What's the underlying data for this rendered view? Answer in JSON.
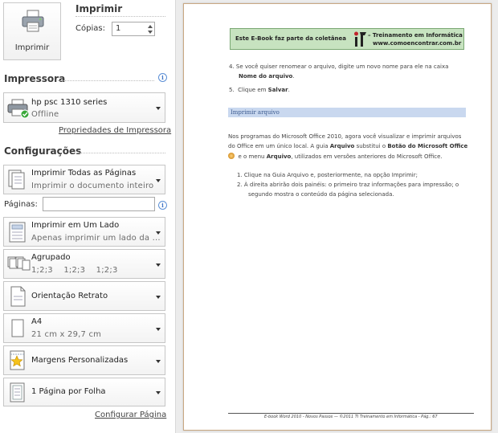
{
  "print_button": {
    "label": "Imprimir"
  },
  "header": {
    "title": "Imprimir"
  },
  "copies": {
    "label": "Cópias:",
    "value": "1"
  },
  "printer_section": {
    "title": "Impressora",
    "printer_name": "hp psc 1310 series",
    "printer_status": "Offline",
    "properties_link": "Propriedades de Impressora"
  },
  "settings": {
    "title": "Configurações",
    "items": [
      {
        "title": "Imprimir Todas as Páginas",
        "subtitle": "Imprimir o documento inteiro"
      },
      {
        "title": "Imprimir em Um Lado",
        "subtitle": "Apenas imprimir um lado da ..."
      },
      {
        "title": "Agrupado",
        "subtitle": "1;2;3    1;2;3    1;2;3"
      },
      {
        "title": "Orientação Retrato",
        "subtitle": ""
      },
      {
        "title": "A4",
        "subtitle": "21 cm x 29,7 cm"
      },
      {
        "title": "Margens Personalizadas",
        "subtitle": ""
      },
      {
        "title": "1 Página por Folha",
        "subtitle": ""
      }
    ],
    "pages_label": "Páginas:",
    "pages_value": "",
    "setup_link": "Configurar Página"
  },
  "preview": {
    "banner_left": "Este E-Book faz parte da coletânea",
    "banner_right": "– Treinamento em Informática",
    "banner_url": "www.comoencontrar.com.br",
    "step4_pre": "4.  Se você quiser renomear o arquivo, digite um novo nome para ele na caixa",
    "step4_bold": "Nome do arquivo",
    "step4_post": ".",
    "step5_pre": "5.  Clique em ",
    "step5_bold": "Salvar",
    "step5_post": ".",
    "subheading": "Imprimir arquivo",
    "para1": "Nos programas do Microsoft Office 2010, agora você visualizar e imprimir arquivos",
    "para2_pre": "do Office em um único local. A guia ",
    "para2_b1": "Arquivo",
    "para2_mid": " substitui o ",
    "para2_b2": "Botão do Microsoft Office",
    "para3_pre": "  e o menu ",
    "para3_b": "Arquivo",
    "para3_post": ", utilizados em versões anteriores do Microsoft Office.",
    "list1": "1.  Clique na Guia Arquivo e, posteriormente, na opção Imprimir;",
    "list2a": "2.  À direita abrirão dois painéis: o primeiro traz informações para impressão; o",
    "list2b": "segundo mostra o conteúdo da página selecionada.",
    "footer": "E-book Word 2010 - Novos Passos — ©2011 TI Treinamento em Informática - Pág.: 67"
  }
}
